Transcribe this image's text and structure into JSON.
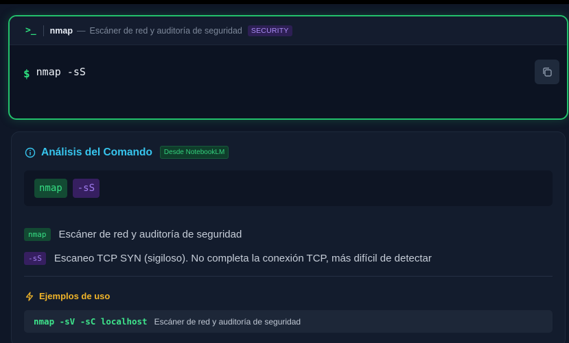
{
  "terminal": {
    "prompt_glyph": ">_",
    "tool_name": "nmap",
    "dash": "—",
    "description": "Escáner de red y auditoría de seguridad",
    "category_badge": "SECURITY",
    "dollar": "$",
    "command": "nmap -sS",
    "copy_icon": "copy-icon"
  },
  "analysis": {
    "info_icon": "info-icon",
    "title": "Análisis del Comando",
    "source_badge": "Desde NotebookLM",
    "tokens": [
      {
        "text": "nmap",
        "color": "green"
      },
      {
        "text": "-sS",
        "color": "purple"
      }
    ],
    "explanations": [
      {
        "tag": "nmap",
        "desc": "Escáner de red y auditoría de seguridad"
      },
      {
        "tag": "-sS",
        "desc": "Escaneo TCP SYN (sigiloso). No completa la conexión TCP, más difícil de detectar"
      }
    ]
  },
  "examples": {
    "icon": "lightning-icon",
    "title": "Ejemplos de uso",
    "items": [
      {
        "cmd": "nmap -sV -sC localhost",
        "desc": "Escáner de red y auditoría de seguridad"
      }
    ]
  },
  "colors": {
    "accent_green": "#23c16c",
    "accent_cyan": "#37c5ee",
    "accent_purple": "#a07df0",
    "accent_amber": "#f0b429",
    "background": "#0f1727"
  }
}
